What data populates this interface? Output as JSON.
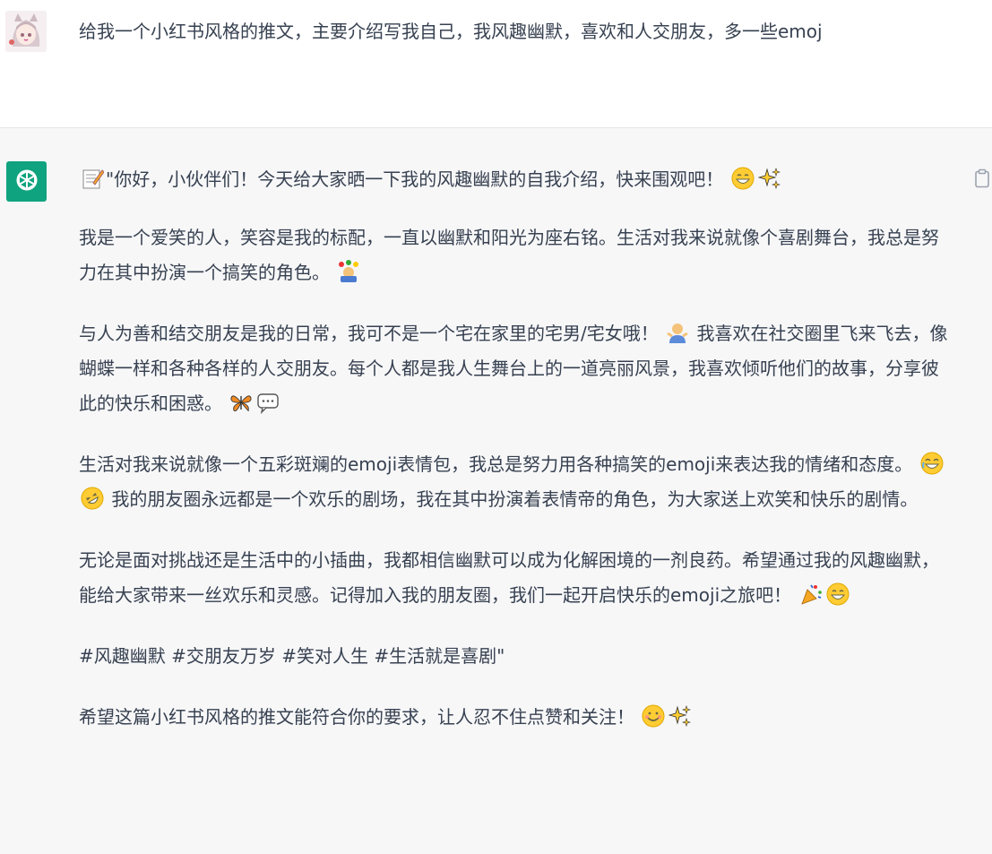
{
  "user": {
    "avatar_icon": "anime-girl-avatar-icon",
    "message": "给我一个小红书风格的推文，主要介绍写我自己，我风趣幽默，喜欢和人交朋友，多一些emoj"
  },
  "assistant": {
    "avatar_icon": "chatgpt-logo-icon",
    "copy_icon": "clipboard-copy-icon",
    "brand_color": "#10a37f",
    "paragraphs": {
      "p1": "\"你好，小伙伴们！今天给大家晒一下我的风趣幽默的自我介绍，快来围观吧！",
      "p2": "我是一个爱笑的人，笑容是我的标配，一直以幽默和阳光为座右铭。生活对我来说就像个喜剧舞台，我总是努力在其中扮演一个搞笑的角色。",
      "p3a": "与人为善和结交朋友是我的日常，我可不是一个宅在家里的宅男/宅女哦！",
      "p3b": "我喜欢在社交圈里飞来飞去，像蝴蝶一样和各种各样的人交朋友。每个人都是我人生舞台上的一道亮丽风景，我喜欢倾听他们的故事，分享彼此的快乐和困惑。",
      "p4a": "生活对我来说就像一个五彩斑斓的emoji表情包，我总是努力用各种搞笑的emoji来表达我的情绪和态度。",
      "p4b": "我的朋友圈永远都是一个欢乐的剧场，我在其中扮演着表情帝的角色，为大家送上欢笑和快乐的剧情。",
      "p5": "无论是面对挑战还是生活中的小插曲，我都相信幽默可以成为化解困境的一剂良药。希望通过我的风趣幽默，能给大家带来一丝欢乐和灵感。记得加入我的朋友圈，我们一起开启快乐的emoji之旅吧！",
      "p6": "#风趣幽默 #交朋友万岁 #笑对人生 #生活就是喜剧\"",
      "p7": "希望这篇小红书风格的推文能符合你的要求，让人忍不住点赞和关注！"
    },
    "emoji_icons": [
      "memo-icon",
      "grin-icon",
      "sparkles-icon",
      "juggler-icon",
      "shrug-icon",
      "butterfly-icon",
      "speech-bubble-icon",
      "joy-icon",
      "rofl-icon",
      "confetti-icon",
      "grin-icon",
      "smile-icon",
      "sparkles-icon"
    ]
  }
}
